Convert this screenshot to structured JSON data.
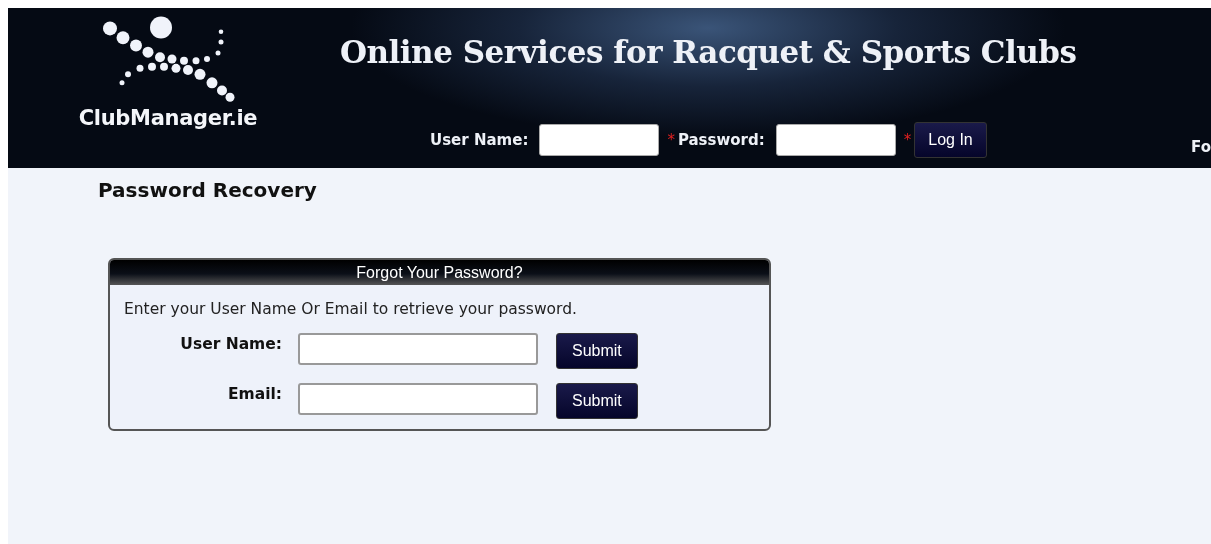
{
  "header": {
    "logo_text": "ClubManager.ie",
    "title": "Online Services for Racquet & Sports Clubs",
    "login": {
      "fields": [
        {
          "label": "User Name:",
          "required_mark": "*"
        },
        {
          "label": "Password:",
          "required_mark": "*"
        }
      ],
      "button": "Log In"
    },
    "cut_text": "Fo"
  },
  "page_title": "Password Recovery",
  "panel": {
    "title": "Forgot Your Password?",
    "intro": "Enter your User Name Or Email to retrieve your password.",
    "rows": [
      {
        "label": "User Name:",
        "button": "Submit"
      },
      {
        "label": "Email:",
        "button": "Submit"
      }
    ]
  }
}
